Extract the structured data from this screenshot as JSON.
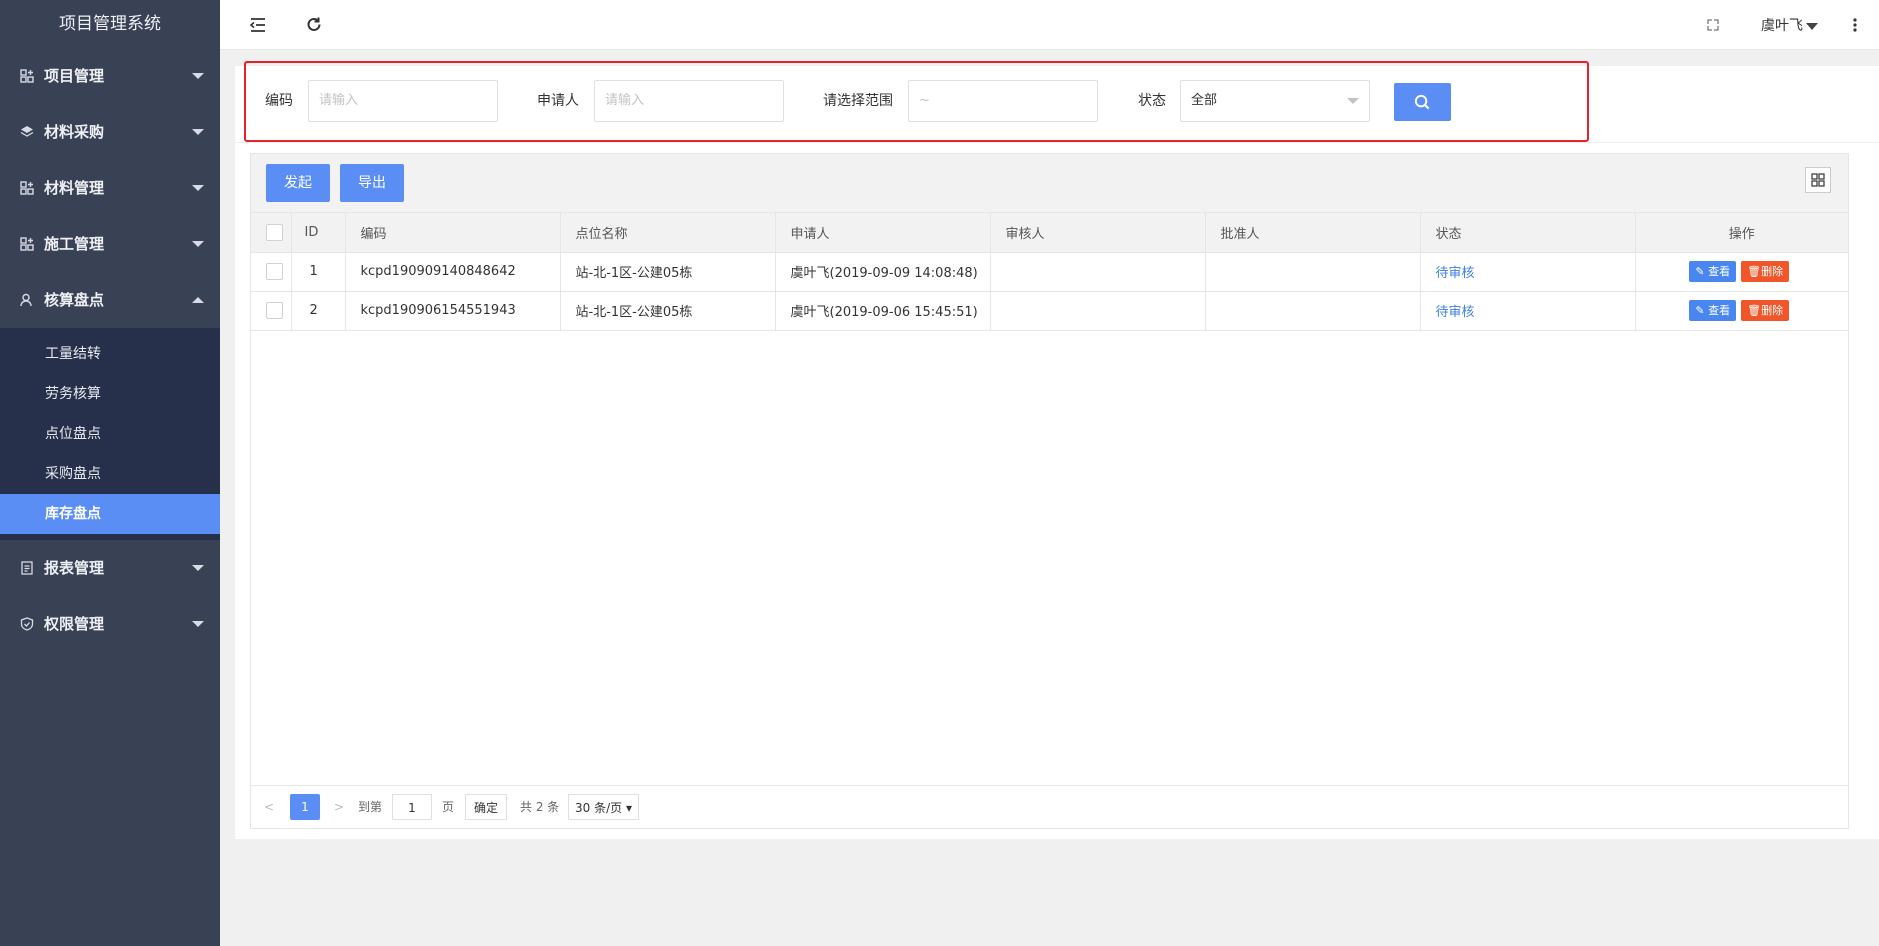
{
  "sidebar": {
    "title": "项目管理系统",
    "items": [
      {
        "label": "项目管理",
        "icon": "grid-plus-icon"
      },
      {
        "label": "材料采购",
        "icon": "layers-icon"
      },
      {
        "label": "材料管理",
        "icon": "grid-plus-icon"
      },
      {
        "label": "施工管理",
        "icon": "grid-plus-icon"
      },
      {
        "label": "核算盘点",
        "icon": "user-icon"
      },
      {
        "label": "报表管理",
        "icon": "report-icon"
      },
      {
        "label": "权限管理",
        "icon": "shield-icon"
      }
    ],
    "submenu": [
      "工量结转",
      "劳务核算",
      "点位盘点",
      "采购盘点",
      "库存盘点"
    ],
    "active_sub": "库存盘点"
  },
  "header": {
    "user": "虞叶飞"
  },
  "filter": {
    "code_label": "编码",
    "code_placeholder": "请输入",
    "applicant_label": "申请人",
    "applicant_placeholder": "请输入",
    "range_label": "请选择范围",
    "range_placeholder": "~",
    "status_label": "状态",
    "status_value": "全部"
  },
  "toolbar": {
    "start_label": "发起",
    "export_label": "导出"
  },
  "table": {
    "columns": [
      "ID",
      "编码",
      "点位名称",
      "申请人",
      "审核人",
      "批准人",
      "状态",
      "操作"
    ],
    "rows": [
      {
        "id": "1",
        "code": "kcpd190909140848642",
        "location": "站-北-1区-公建05栋",
        "applicant": "虞叶飞(2019-09-09 14:08:48)",
        "reviewer": "",
        "approver": "",
        "status": "待审核"
      },
      {
        "id": "2",
        "code": "kcpd190906154551943",
        "location": "站-北-1区-公建05栋",
        "applicant": "虞叶飞(2019-09-06 15:45:51)",
        "reviewer": "",
        "approver": "",
        "status": "待审核"
      }
    ],
    "view_label": "查看",
    "delete_label": "删除"
  },
  "pager": {
    "current": "1",
    "goto_label": "到第",
    "goto_value": "1",
    "page_label": "页",
    "confirm_label": "确定",
    "total_label": "共 2 条",
    "page_size": "30 条/页"
  },
  "colors": {
    "sidebar_bg": "#394155",
    "submenu_bg": "#27304a",
    "accent": "#5a8ef5",
    "danger": "#f0562a",
    "highlight_outline": "#e8222d"
  }
}
